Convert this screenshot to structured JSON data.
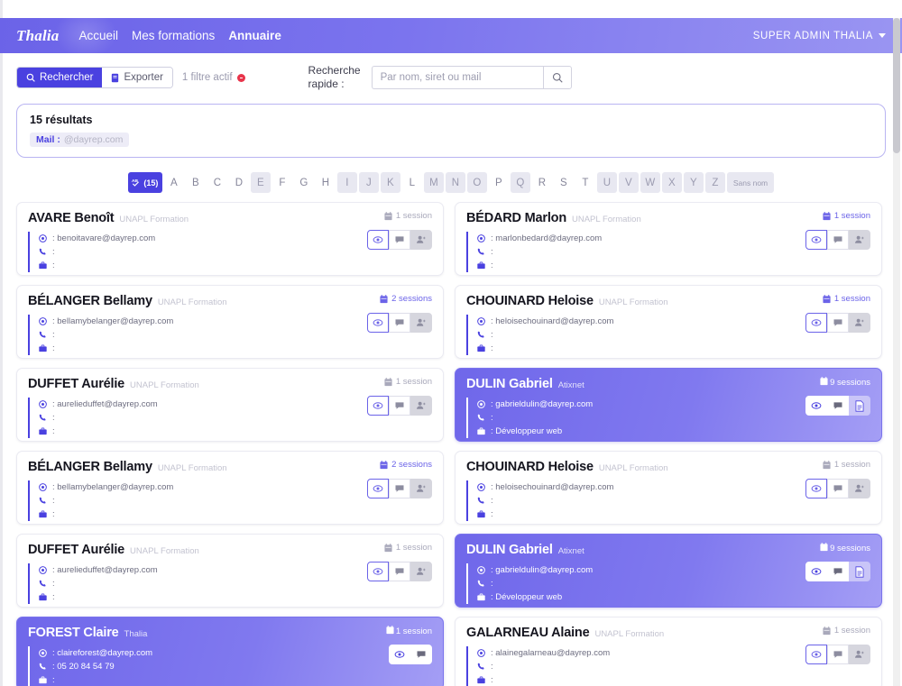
{
  "navbar": {
    "brand": "Thalia",
    "links": [
      {
        "label": "Accueil",
        "active": false
      },
      {
        "label": "Mes formations",
        "active": false
      },
      {
        "label": "Annuaire",
        "active": true
      }
    ],
    "user": "SUPER ADMIN THALIA"
  },
  "toolbar": {
    "search_label": "Rechercher",
    "export_label": "Exporter",
    "filter_note": "1 filtre actif",
    "quick_label_line1": "Recherche",
    "quick_label_line2": "rapide :",
    "quick_placeholder": "Par nom, siret ou mail",
    "quick_value": ""
  },
  "results": {
    "title": "15 résultats",
    "chips": [
      {
        "key": "Mail :",
        "value": "@dayrep.com"
      }
    ]
  },
  "alphabet": {
    "all_label": "(15)",
    "all_icon": "AB-check-icon",
    "letters": [
      {
        "l": "A",
        "enabled": true
      },
      {
        "l": "B",
        "enabled": true
      },
      {
        "l": "C",
        "enabled": true
      },
      {
        "l": "D",
        "enabled": true
      },
      {
        "l": "E",
        "enabled": false
      },
      {
        "l": "F",
        "enabled": true
      },
      {
        "l": "G",
        "enabled": true
      },
      {
        "l": "H",
        "enabled": true
      },
      {
        "l": "I",
        "enabled": false
      },
      {
        "l": "J",
        "enabled": false
      },
      {
        "l": "K",
        "enabled": false
      },
      {
        "l": "L",
        "enabled": true
      },
      {
        "l": "M",
        "enabled": false
      },
      {
        "l": "N",
        "enabled": false
      },
      {
        "l": "O",
        "enabled": false
      },
      {
        "l": "P",
        "enabled": true
      },
      {
        "l": "Q",
        "enabled": false
      },
      {
        "l": "R",
        "enabled": true
      },
      {
        "l": "S",
        "enabled": true
      },
      {
        "l": "T",
        "enabled": true
      },
      {
        "l": "U",
        "enabled": false
      },
      {
        "l": "V",
        "enabled": false
      },
      {
        "l": "W",
        "enabled": false
      },
      {
        "l": "X",
        "enabled": false
      },
      {
        "l": "Y",
        "enabled": false
      },
      {
        "l": "Z",
        "enabled": false
      }
    ],
    "noname_label": "Sans nom"
  },
  "colors": {
    "brand_purple": "#4a41e0",
    "nav_gradient_start": "#6b63e8",
    "nav_gradient_end": "#9a95f2",
    "accent_text": "#6b63e8",
    "danger": "#e8344a",
    "muted": "#a9a9bb"
  },
  "cards": [
    {
      "name": "AVARE Benoît",
      "org": "UNAPL Formation",
      "email": "benoitavare@dayrep.com",
      "phone": "",
      "job": "",
      "sessions": "1 session",
      "sessions_accent": false,
      "highlighted": false,
      "actions": [
        "eye-icon",
        "comment-icon",
        "person-add-icon"
      ]
    },
    {
      "name": "BÉDARD Marlon",
      "org": "UNAPL Formation",
      "email": "marlonbedard@dayrep.com",
      "phone": "",
      "job": "",
      "sessions": "1 session",
      "sessions_accent": true,
      "highlighted": false,
      "actions": [
        "eye-icon",
        "comment-icon",
        "person-add-icon"
      ]
    },
    {
      "name": "BÉLANGER Bellamy",
      "org": "UNAPL Formation",
      "email": "bellamybelanger@dayrep.com",
      "phone": "",
      "job": "",
      "sessions": "2 sessions",
      "sessions_accent": true,
      "highlighted": false,
      "actions": [
        "eye-icon",
        "comment-icon",
        "person-add-icon"
      ]
    },
    {
      "name": "CHOUINARD Heloise",
      "org": "UNAPL Formation",
      "email": "heloisechouinard@dayrep.com",
      "phone": "",
      "job": "",
      "sessions": "1 session",
      "sessions_accent": true,
      "highlighted": false,
      "actions": [
        "eye-icon",
        "comment-icon",
        "person-add-icon"
      ]
    },
    {
      "name": "DUFFET Aurélie",
      "org": "UNAPL Formation",
      "email": "aurelieduffet@dayrep.com",
      "phone": "",
      "job": "",
      "sessions": "1 session",
      "sessions_accent": false,
      "highlighted": false,
      "actions": [
        "eye-icon",
        "comment-icon",
        "person-add-icon"
      ]
    },
    {
      "name": "DULIN Gabriel",
      "org": "Atixnet",
      "email": "gabrieldulin@dayrep.com",
      "phone": "",
      "job": "Développeur web",
      "sessions": "9 sessions",
      "sessions_accent": false,
      "highlighted": true,
      "actions": [
        "eye-icon",
        "comment-icon",
        "file-icon"
      ]
    },
    {
      "name": "BÉLANGER Bellamy",
      "org": "UNAPL Formation",
      "email": "bellamybelanger@dayrep.com",
      "phone": "",
      "job": "",
      "sessions": "2 sessions",
      "sessions_accent": true,
      "highlighted": false,
      "actions": [
        "eye-icon",
        "comment-icon",
        "person-add-icon"
      ]
    },
    {
      "name": "CHOUINARD Heloise",
      "org": "UNAPL Formation",
      "email": "heloisechouinard@dayrep.com",
      "phone": "",
      "job": "",
      "sessions": "1 session",
      "sessions_accent": false,
      "highlighted": false,
      "actions": [
        "eye-icon",
        "comment-icon",
        "person-add-icon"
      ]
    },
    {
      "name": "DUFFET Aurélie",
      "org": "UNAPL Formation",
      "email": "aurelieduffet@dayrep.com",
      "phone": "",
      "job": "",
      "sessions": "1 session",
      "sessions_accent": false,
      "highlighted": false,
      "actions": [
        "eye-icon",
        "comment-icon",
        "person-add-icon"
      ]
    },
    {
      "name": "DULIN Gabriel",
      "org": "Atixnet",
      "email": "gabrieldulin@dayrep.com",
      "phone": "",
      "job": "Développeur web",
      "sessions": "9 sessions",
      "sessions_accent": false,
      "highlighted": true,
      "actions": [
        "eye-icon",
        "comment-icon",
        "file-icon"
      ]
    },
    {
      "name": "FOREST Claire",
      "org": "Thalia",
      "email": "claireforest@dayrep.com",
      "phone": "05 20 84 54 79",
      "job": "",
      "sessions": "1 session",
      "sessions_accent": false,
      "highlighted": true,
      "actions": [
        "eye-icon",
        "comment-icon"
      ]
    },
    {
      "name": "GALARNEAU Alaine",
      "org": "UNAPL Formation",
      "email": "alainegalarneau@dayrep.com",
      "phone": "",
      "job": "",
      "sessions": "1 session",
      "sessions_accent": false,
      "highlighted": false,
      "actions": [
        "eye-icon",
        "comment-icon",
        "person-add-icon"
      ]
    }
  ],
  "icons": {
    "email": "@",
    "phone": "phone-icon",
    "job": "briefcase-icon",
    "sessions": "calendar-icon"
  }
}
